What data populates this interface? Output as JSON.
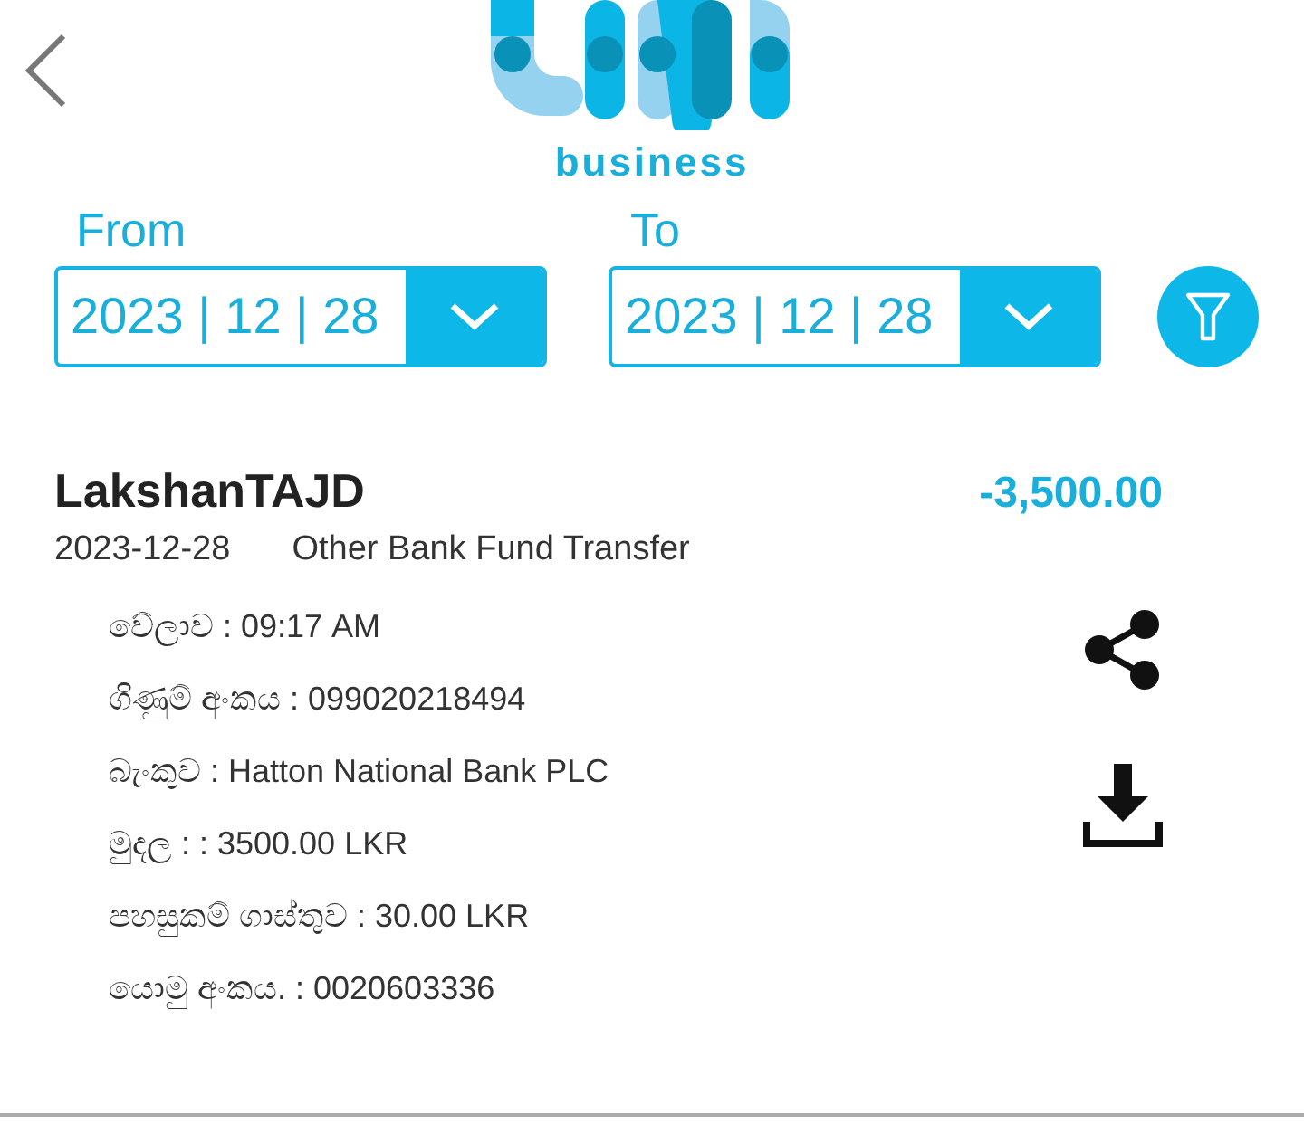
{
  "header": {
    "logo_caption": "business"
  },
  "filters": [
    {
      "label": "From",
      "value": "2023 | 12 | 28"
    },
    {
      "label": "To",
      "value": "2023 | 12 | 28"
    }
  ],
  "transaction": {
    "name": "LakshanTAJD",
    "amount": "-3,500.00",
    "date": "2023-12-28",
    "type": "Other Bank Fund Transfer",
    "details": [
      {
        "label": "වේලාව",
        "value": " : 09:17 AM"
      },
      {
        "label": "ගිණුම් අංකය",
        "value": " : 099020218494"
      },
      {
        "label": "බැංකුව",
        "value": " : Hatton National Bank PLC"
      },
      {
        "label": "මුදල",
        "value": ": : 3500.00 LKR"
      },
      {
        "label": "පහසුකම් ගාස්තුව",
        "value": ": 30.00 LKR"
      },
      {
        "label": "යොමු අංකය.",
        "value": " : 0020603336"
      }
    ]
  }
}
